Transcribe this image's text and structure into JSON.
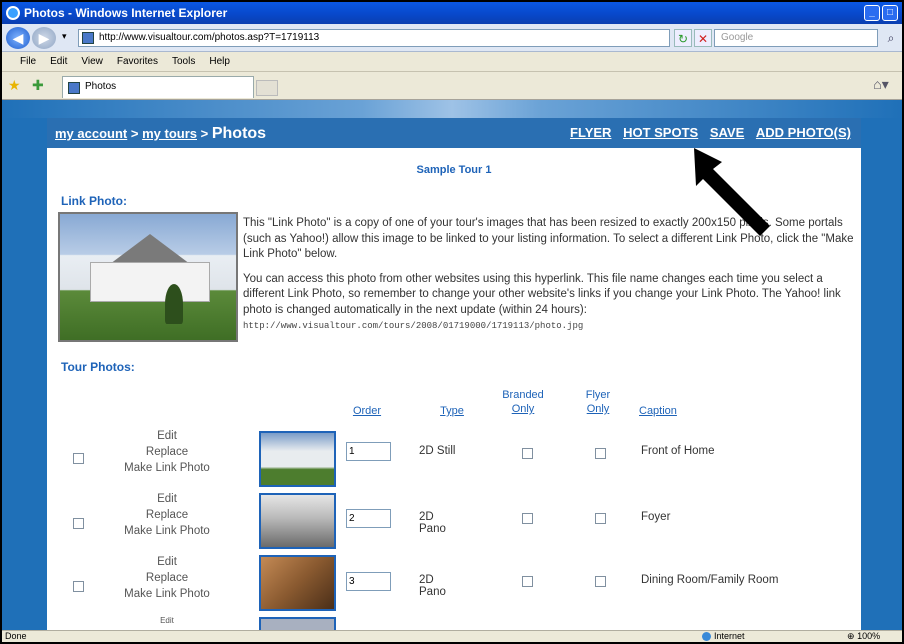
{
  "window": {
    "title": "Photos - Windows Internet Explorer"
  },
  "toolbar": {
    "address": "http://www.visualtour.com/photos.asp?T=1719113",
    "search_placeholder": "Google"
  },
  "menu": [
    "File",
    "Edit",
    "View",
    "Favorites",
    "Tools",
    "Help"
  ],
  "tab": {
    "label": "Photos"
  },
  "page": {
    "breadcrumb": {
      "account": "my account",
      "sep1": ">",
      "tours": "my tours",
      "sep2": ">",
      "current": "Photos"
    },
    "top_links": {
      "flyer": "FLYER",
      "hotspots": "HOT SPOTS",
      "save": "SAVE",
      "add": "ADD PHOTO(S)"
    },
    "tour_title": "Sample Tour 1",
    "link_photo_header": "Link Photo:",
    "link_text_1": "This \"Link Photo\" is a copy of one of your tour's images that has been resized to exactly 200x150 pixels. Some portals (such as Yahoo!) allow this image to be linked to your listing information. To select a different Link Photo, click the \"Make Link Photo\" below.",
    "link_text_2": "You can access this photo from other websites using this hyperlink. This file name changes each time you select a different Link Photo, so remember to change your other website's links if you change your Link Photo. The Yahoo! link photo is changed automatically in the next update (within 24 hours):",
    "link_url": "http://www.visualtour.com/tours/2008/01719000/1719113/photo.jpg",
    "tour_photos_header": "Tour Photos:",
    "columns": {
      "order": "Order",
      "type": "Type",
      "branded1": "Branded",
      "branded2": "Only",
      "flyer1": "Flyer",
      "flyer2": "Only",
      "caption": "Caption"
    },
    "actions": {
      "edit": "Edit",
      "replace": "Replace",
      "make": "Make Link Photo"
    },
    "rows": [
      {
        "order": "1",
        "type": "2D Still",
        "caption": "Front of Home",
        "thumb_colors": [
          "#7a9cc8",
          "#e8ecef",
          "#4d7d2e"
        ]
      },
      {
        "order": "2",
        "type": "2D Pano",
        "caption": "Foyer",
        "thumb_colors": [
          "#e6e6e6",
          "#b8b8b8",
          "#6b6b6b"
        ]
      },
      {
        "order": "3",
        "type": "2D Pano",
        "caption": "Dining Room/Family Room",
        "thumb_colors": [
          "#c48a55",
          "#8a5a30",
          "#4a2e18"
        ]
      },
      {
        "order": "",
        "type": "",
        "caption": "",
        "partial_edit": "Edit"
      }
    ]
  },
  "status": {
    "left": "Done",
    "zone": "Internet",
    "zoom": "100%"
  }
}
